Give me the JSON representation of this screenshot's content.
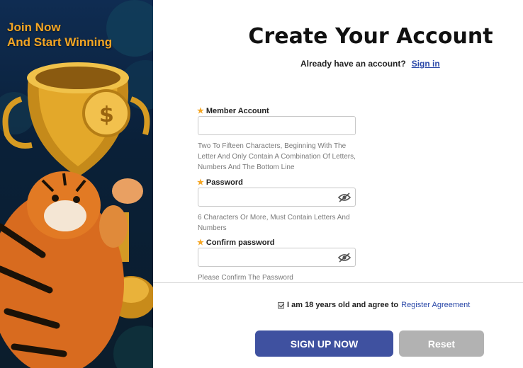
{
  "promo": {
    "headline_line1": "Join Now",
    "headline_line2": "And Start Winning"
  },
  "header": {
    "title": "Create Your Account",
    "already_text": "Already have an account?",
    "signin_link": "Sign in"
  },
  "form": {
    "member_account": {
      "label": "Member Account",
      "value": "",
      "hint": "Two To Fifteen Characters, Beginning With The Letter And Only Contain A Combination Of Letters, Numbers And The Bottom Line"
    },
    "password": {
      "label": "Password",
      "value": "",
      "hint": "6 Characters Or More, Must Contain Letters And Numbers"
    },
    "confirm_password": {
      "label": "Confirm password",
      "value": "",
      "hint": "Please Confirm The Password"
    }
  },
  "agreement": {
    "checked": true,
    "text": "I am 18 years old and agree to",
    "link": "Register Agreement"
  },
  "buttons": {
    "signup": "SIGN UP NOW",
    "reset": "Reset"
  },
  "colors": {
    "accent": "#3f51a0",
    "star": "#f5a623",
    "link": "#2a48a8",
    "reset": "#b2b2b2"
  },
  "icons": [
    "star-icon",
    "eye-off-icon",
    "checkbox-icon",
    "trophy-icon",
    "tiger-illustration"
  ]
}
